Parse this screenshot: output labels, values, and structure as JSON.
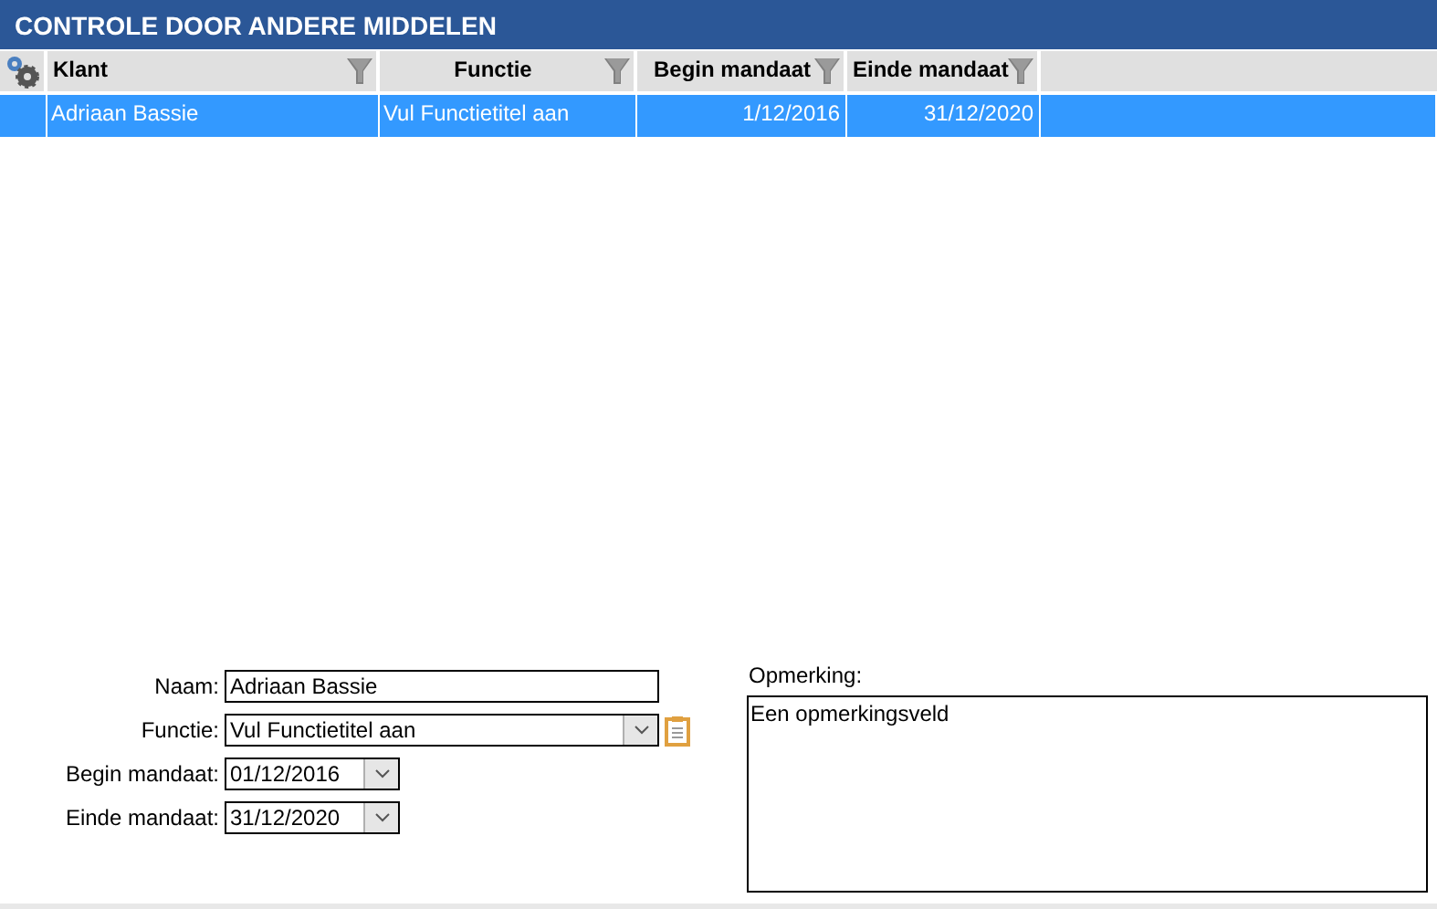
{
  "window": {
    "title": "CONTROLE DOOR ANDERE MIDDELEN"
  },
  "table": {
    "columns": [
      {
        "label": "Klant"
      },
      {
        "label": "Functie"
      },
      {
        "label": "Begin mandaat"
      },
      {
        "label": "Einde mandaat"
      }
    ],
    "rows": [
      {
        "selected": true,
        "cells": [
          "Adriaan Bassie",
          "Vul Functietitel aan",
          "1/12/2016",
          "31/12/2020"
        ]
      }
    ]
  },
  "form": {
    "fields": [
      {
        "kind": "text",
        "label": "Naam:",
        "value": "Adriaan Bassie"
      },
      {
        "kind": "select",
        "label": "Functie:",
        "value": "Vul Functietitel aan"
      },
      {
        "kind": "date",
        "label": "Begin mandaat:",
        "value": "01/12/2016"
      },
      {
        "kind": "date",
        "label": "Einde mandaat:",
        "value": "31/12/2020"
      }
    ],
    "remark": {
      "label": "Opmerking:",
      "value": "Een opmerkingsveld"
    }
  }
}
